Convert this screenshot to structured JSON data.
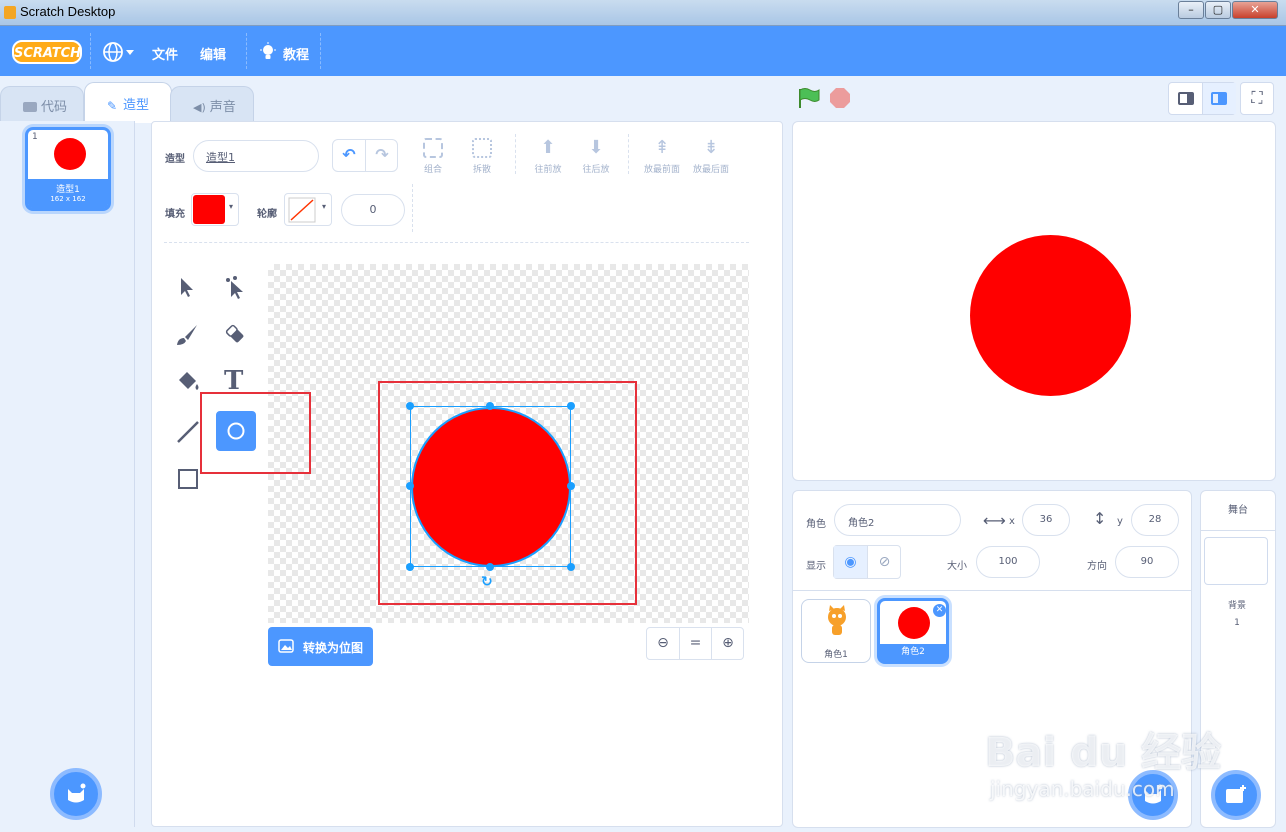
{
  "window": {
    "title": "Scratch Desktop",
    "min": "–",
    "max": "▢",
    "close": "✕"
  },
  "menubar": {
    "logo": "SCRATCH",
    "language_icon": "globe-icon",
    "file": "文件",
    "edit": "编辑",
    "tutorials": "教程"
  },
  "tabs": {
    "code": "代码",
    "costumes": "造型",
    "sounds": "声音"
  },
  "costume_list": [
    {
      "index": "1",
      "name": "造型1",
      "size": "162 x 162"
    }
  ],
  "editor": {
    "costume_label": "造型",
    "costume_name": "造型1",
    "group": "组合",
    "ungroup": "拆散",
    "forward": "往前放",
    "backward": "往后放",
    "front": "放最前面",
    "back": "放最后面",
    "fill_label": "填充",
    "fill_color": "#ff0000",
    "outline_label": "轮廓",
    "outline_width": "0",
    "convert_button": "转换为位图",
    "zoom_equal": "="
  },
  "stage_controls": {
    "green_flag": "green-flag-icon",
    "stop": "stop-icon"
  },
  "sprite_info": {
    "sprite_label": "角色",
    "sprite_name": "角色2",
    "x_label": "x",
    "x_value": "36",
    "y_label": "y",
    "y_value": "28",
    "show_label": "显示",
    "size_label": "大小",
    "size_value": "100",
    "direction_label": "方向",
    "direction_value": "90"
  },
  "sprites": [
    {
      "name": "角色1"
    },
    {
      "name": "角色2"
    }
  ],
  "stage_panel": {
    "title": "舞台",
    "backdrops_label": "背景",
    "backdrops_count": "1"
  },
  "watermark": {
    "line1": "Bai du 经验",
    "line2": "jingyan.baidu.com"
  },
  "colors": {
    "accent": "#4c97ff",
    "highlight_box": "#e6303a",
    "shape_fill": "#ff0000"
  }
}
